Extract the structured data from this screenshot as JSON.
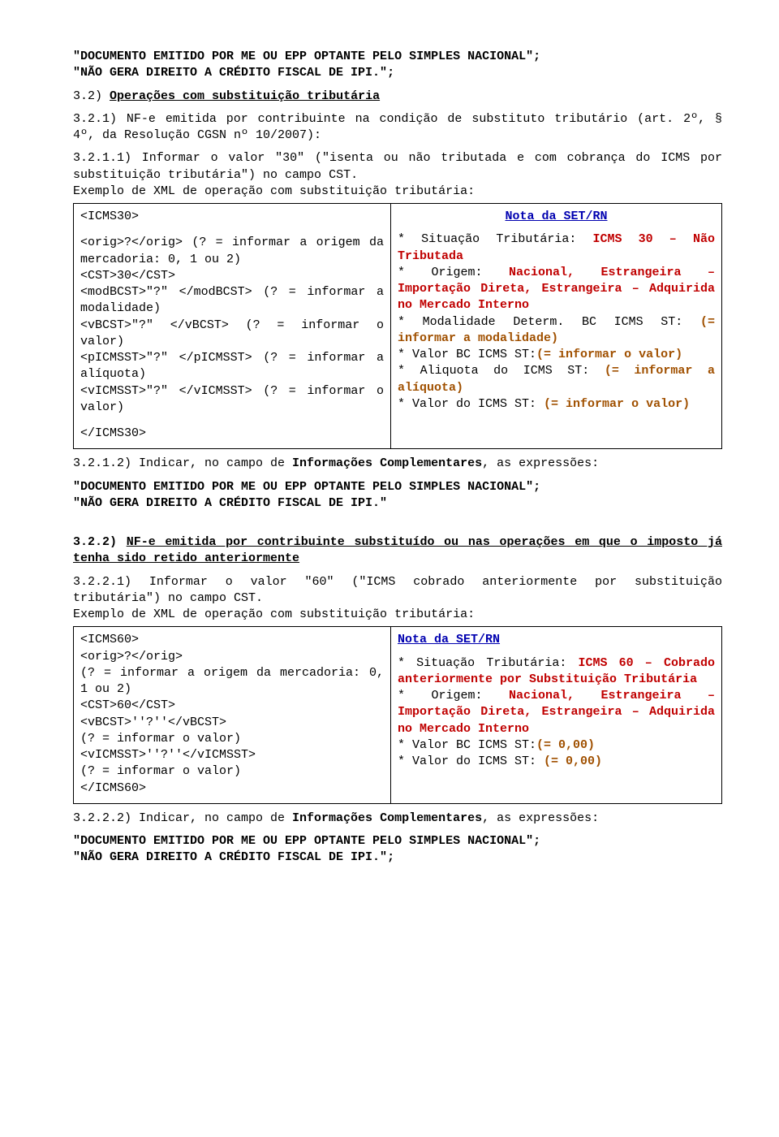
{
  "top": {
    "l1": "\"DOCUMENTO EMITIDO POR ME OU EPP OPTANTE PELO SIMPLES NACIONAL\";",
    "l2": "\"NÃO GERA DIREITO A CRÉDITO FISCAL DE IPI.\";"
  },
  "s32": {
    "num": "3.2)",
    "title": "Operações com substituição tributária"
  },
  "s321": {
    "txt1": "3.2.1) NF-e emitida por contribuinte na condição de substituto tributário (art. 2º, § 4º, da Resolução CGSN nº 10/2007):",
    "t11a": "3.2.1.1) Informar o valor \"30\" (",
    "t11b": "\"isenta ou não tributada e com cobrança do ICMS por substituição tributária\"",
    "t11c": ") no campo CST.",
    "ex": "Exemplo de XML de operação com substituição tributária:"
  },
  "b1": {
    "l1": "<ICMS30>",
    "l2": "<orig>?</orig> (? = informar a origem da mercadoria: 0, 1 ou 2)",
    "l3": "<CST>30</CST>",
    "l4": "<modBCST>\"?\" </modBCST> (? = informar a modalidade)",
    "l5": "<vBCST>\"?\" </vBCST> (? = informar o valor)",
    "l6": "<pICMSST>\"?\" </pICMSST> (? = informar a alíquota)",
    "l7": "<vICMSST>\"?\" </vICMSST> (? = informar o valor)",
    "l8": "</ICMS30>"
  },
  "n1": {
    "title": "Nota da SET/RN",
    "s1a": "* Situação Tributária: ",
    "s1b": "ICMS 30 – Não Tributada",
    "s2a": "* Origem: ",
    "s2b": "Nacional, Estrangeira – Importação Direta, Estrangeira – Adquirida no Mercado Interno",
    "s3a": "* Modalidade Determ. BC ICMS ST: ",
    "s3b": "(= informar a modalidade)",
    "s4a": "* Valor BC ICMS ST:",
    "s4b": "(= informar o valor)",
    "s5a": "* Aliquota do ICMS ST: ",
    "s5b": "(= informar a alíquota)",
    "s6a": "* Valor do ICMS ST: ",
    "s6b": "(= informar o valor)"
  },
  "s3212": {
    "a": "3.2.1.2) Indicar, no campo de ",
    "b": "Informações Complementares",
    "c": ", as expressões:"
  },
  "rep1": {
    "l1": "\"DOCUMENTO EMITIDO POR ME OU EPP OPTANTE PELO SIMPLES NACIONAL\";",
    "l2": "\"NÃO GERA DIREITO A CRÉDITO FISCAL DE IPI.\""
  },
  "s322": {
    "num": "3.2.2)",
    "title": "NF-e emitida por contribuinte substituído ou nas operações em que o imposto já tenha sido retido anteriormente",
    "t21a": "3.2.2.1) Informar o valor \"60\" (",
    "t21b": "\"ICMS cobrado anteriormente por substituição tributária\"",
    "t21c": ") no campo CST.",
    "ex": "Exemplo de XML de operação com substituição tributária:"
  },
  "b2": {
    "l1": "<ICMS60>",
    "l2": "<orig>?</orig>",
    "l3": "(? = informar a origem da mercadoria: 0, 1 ou 2)",
    "l4": "<CST>60</CST>",
    "l5": "<vBCST>''?''</vBCST>",
    "l6": "(? = informar o valor)",
    "l7": "<vICMSST>''?''</vICMSST>",
    "l8": "(? = informar o valor)",
    "l9": "</ICMS60>"
  },
  "n2": {
    "title": "Nota da SET/RN",
    "s1a": "* Situação Tributária: ",
    "s1b": "ICMS 60 – Cobrado anteriormente por Substituição Tributária",
    "s2a": "* Origem: ",
    "s2b": "Nacional, Estrangeira – Importação Direta, Estrangeira – Adquirida no Mercado Interno",
    "s3a": "* Valor BC ICMS ST:",
    "s3b": "(= 0,00)",
    "s4a": "* Valor do ICMS ST: ",
    "s4b": "(= 0,00)"
  },
  "s3222": {
    "a": "3.2.2.2) Indicar, no campo de ",
    "b": "Informações Complementares",
    "c": ", as expressões:"
  },
  "rep2": {
    "l1": "\"DOCUMENTO EMITIDO POR ME OU EPP OPTANTE PELO SIMPLES NACIONAL\";",
    "l2": "\"NÃO GERA DIREITO A CRÉDITO FISCAL DE IPI.\";"
  }
}
